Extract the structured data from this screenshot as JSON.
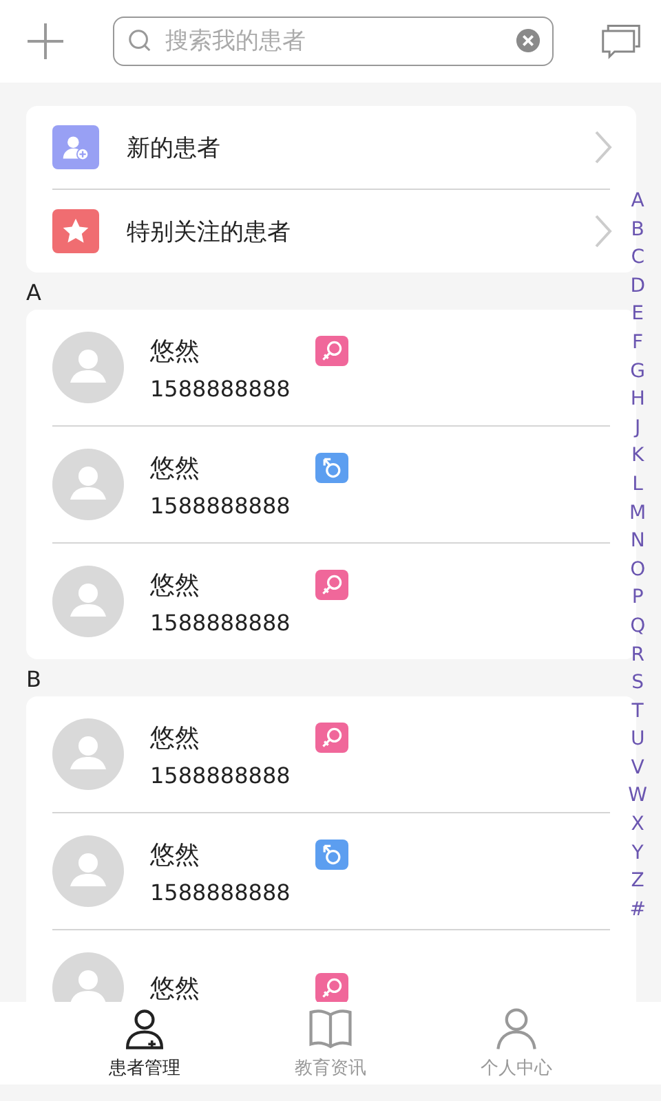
{
  "search": {
    "placeholder": "搜索我的患者"
  },
  "quick_entries": [
    {
      "kind": "new",
      "label": "新的患者"
    },
    {
      "kind": "starred",
      "label": "特别关注的患者"
    }
  ],
  "groups": [
    {
      "letter": "A",
      "patients": [
        {
          "name": "悠然",
          "phone": "1588888888",
          "kind": "female"
        },
        {
          "name": "悠然",
          "phone": "1588888888",
          "kind": "male"
        },
        {
          "name": "悠然",
          "phone": "1588888888",
          "kind": "female"
        }
      ]
    },
    {
      "letter": "B",
      "patients": [
        {
          "name": "悠然",
          "phone": "1588888888",
          "kind": "female"
        },
        {
          "name": "悠然",
          "phone": "1588888888",
          "kind": "male"
        },
        {
          "name": "悠然",
          "kind": "female"
        }
      ]
    }
  ],
  "index_letters": [
    "A",
    "B",
    "C",
    "D",
    "E",
    "F",
    "G",
    "H",
    "J",
    "K",
    "L",
    "M",
    "N",
    "O",
    "P",
    "Q",
    "R",
    "S",
    "T",
    "U",
    "V",
    "W",
    "X",
    "Y",
    "Z",
    "#"
  ],
  "tabs": [
    {
      "label": "患者管理",
      "kind": "patients",
      "selected": true
    },
    {
      "label": "教育资讯",
      "kind": "education",
      "selected": false
    },
    {
      "label": "个人中心",
      "kind": "profile",
      "selected": false
    }
  ]
}
